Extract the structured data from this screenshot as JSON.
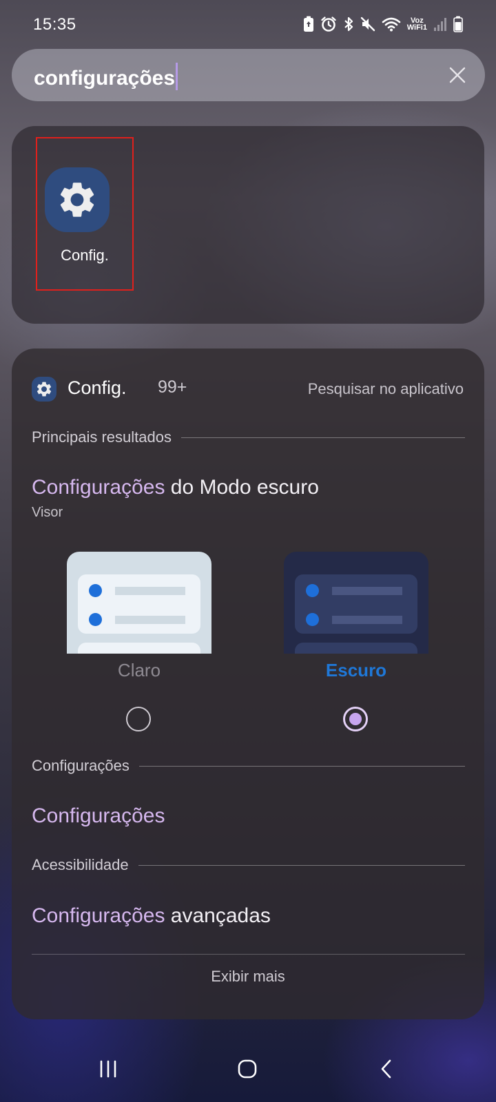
{
  "status_bar": {
    "time": "15:35",
    "voz_line1": "Voz",
    "voz_line2": "WiFi1",
    "icons": [
      "battery-saver-icon",
      "alarm-icon",
      "bluetooth-icon",
      "mute-icon",
      "wifi-icon",
      "signal-icon",
      "battery-icon"
    ]
  },
  "search": {
    "query": "configurações",
    "clear_icon": "close-icon"
  },
  "apps": [
    {
      "label": "Config.",
      "icon": "gear-icon",
      "highlighted": true
    }
  ],
  "results": {
    "app_name": "Config.",
    "count": "99+",
    "search_in_app": "Pesquisar no aplicativo",
    "sections": {
      "top": "Principais resultados",
      "settings": "Configurações",
      "accessibility": "Acessibilidade"
    },
    "dark_mode": {
      "title_highlight": "Configurações",
      "title_rest": " do Modo escuro",
      "subtitle": "Visor",
      "options": [
        {
          "label": "Claro",
          "selected": false
        },
        {
          "label": "Escuro",
          "selected": true
        }
      ]
    },
    "settings_item": "Configurações",
    "advanced": {
      "highlight": "Configurações",
      "rest": " avançadas"
    },
    "show_more": "Exibir mais"
  },
  "colors": {
    "highlight_text": "#d6b8ef",
    "selected_option": "#1f78d8",
    "annotation_box": "#e0201c",
    "app_icon_bg": "#2f4c7f"
  }
}
